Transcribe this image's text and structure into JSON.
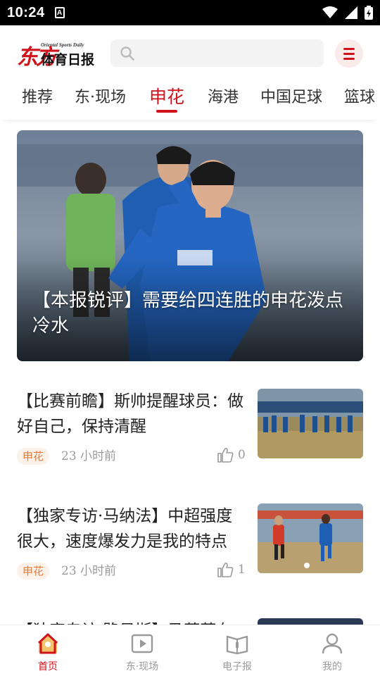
{
  "status_bar": {
    "time": "10:24",
    "notification_badge": "A"
  },
  "header": {
    "logo_big": "东方",
    "logo_en": "Oriental Sports Daily",
    "logo_cn": "体育日报",
    "search_placeholder": "",
    "brand_color": "#d0121b"
  },
  "tabs": [
    {
      "label": "推荐",
      "active": false
    },
    {
      "label": "东·现场",
      "active": false
    },
    {
      "label": "申花",
      "active": true
    },
    {
      "label": "海港",
      "active": false
    },
    {
      "label": "中国足球",
      "active": false
    },
    {
      "label": "篮球",
      "active": false
    }
  ],
  "hero": {
    "title": "【本报锐评】需要给四连胜的申花泼点冷水"
  },
  "news": [
    {
      "title": "【比赛前瞻】斯帅提醒球员：做好自己，保持清醒",
      "tag": "申花",
      "time": "23 小时前",
      "likes": "0"
    },
    {
      "title": "【独家专访·马纳法】中超强度很大，速度爆发力是我的特点",
      "tag": "申花",
      "time": "23 小时前",
      "likes": "1"
    },
    {
      "title": "【独家专访·路易斯】马莱莱在",
      "tag": "",
      "time": "",
      "likes": ""
    }
  ],
  "bottom_nav": [
    {
      "label": "首页",
      "icon": "home-icon",
      "active": true
    },
    {
      "label": "东·现场",
      "icon": "video-play-icon",
      "active": false
    },
    {
      "label": "电子报",
      "icon": "newspaper-icon",
      "active": false
    },
    {
      "label": "我的",
      "icon": "profile-icon",
      "active": false
    }
  ]
}
